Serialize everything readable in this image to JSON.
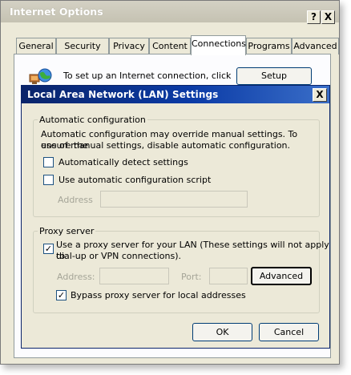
{
  "outer_window": {
    "title": "Internet Options",
    "help_button": "?",
    "close_button": "X",
    "tabs": [
      "General",
      "Security",
      "Privacy",
      "Content",
      "Connections",
      "Programs",
      "Advanced"
    ],
    "active_tab": "Connections",
    "setup_text": "To set up an Internet connection, click",
    "setup_button": "Setup"
  },
  "lan_dialog": {
    "title": "Local Area Network (LAN) Settings",
    "close_button": "X",
    "auto_config": {
      "label": "Automatic configuration",
      "description_line1": "Automatic configuration may override manual settings.  To ensure the",
      "description_line2": "use of manual settings, disable automatic configuration.",
      "detect_settings_label": "Automatically detect settings",
      "detect_settings_checked": false,
      "script_label": "Use automatic configuration script",
      "script_checked": false,
      "address_label": "Address",
      "address_value": ""
    },
    "proxy_server": {
      "label": "Proxy server",
      "use_proxy_label_line1": "Use a proxy server for your LAN (These settings will not apply to",
      "use_proxy_label_line2": "dial-up or VPN connections).",
      "use_proxy_checked": true,
      "address_label": "Address:",
      "address_value": "",
      "port_label": "Port:",
      "port_value": "",
      "advanced_button": "Advanced",
      "bypass_label": "Bypass proxy server for local addresses",
      "bypass_checked": true
    },
    "ok_button": "OK",
    "cancel_button": "Cancel"
  }
}
